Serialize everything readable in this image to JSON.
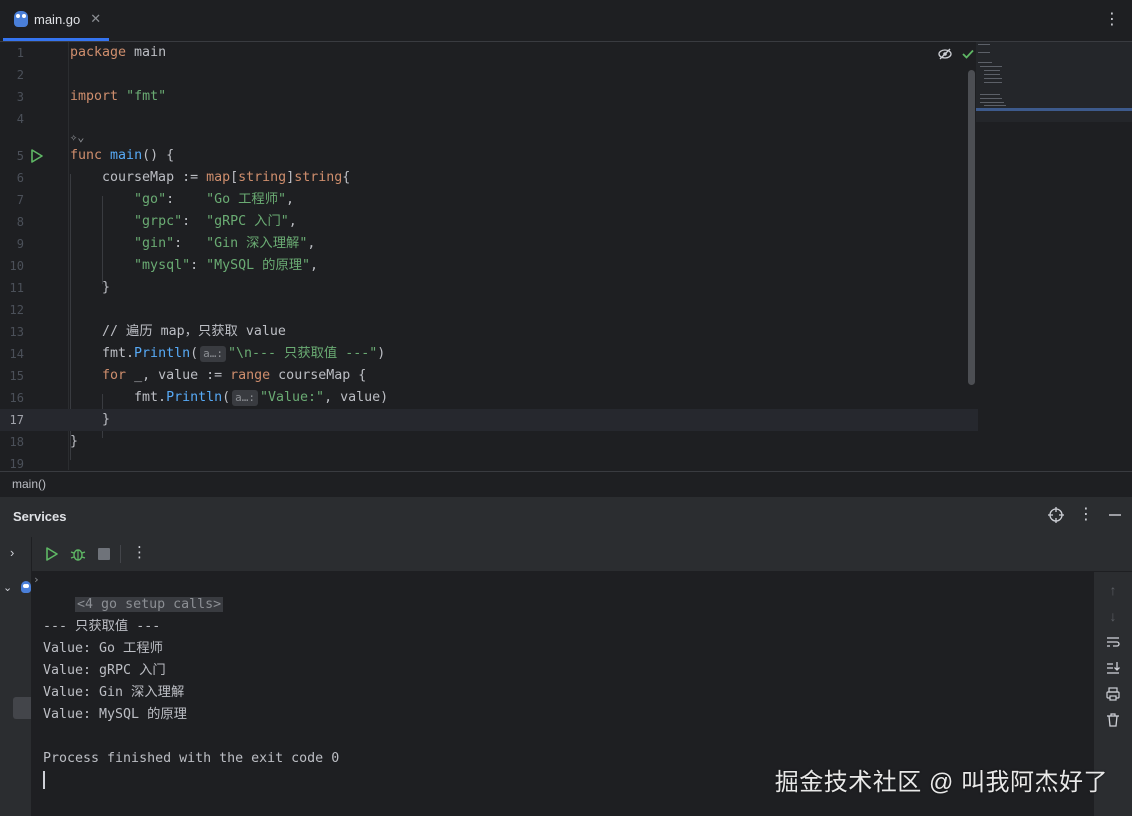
{
  "tab": {
    "filename": "main.go"
  },
  "editor": {
    "lines": [
      {
        "n": "1",
        "code": "package main"
      },
      {
        "n": "2",
        "code": ""
      },
      {
        "n": "3",
        "code": "import \"fmt\""
      },
      {
        "n": "4",
        "code": ""
      },
      {
        "n": "5",
        "code": "func main() {"
      },
      {
        "n": "6",
        "code": "    courseMap := map[string]string{"
      },
      {
        "n": "7",
        "code": "        \"go\":    \"Go 工程师\","
      },
      {
        "n": "8",
        "code": "        \"grpc\":  \"gRPC 入门\","
      },
      {
        "n": "9",
        "code": "        \"gin\":   \"Gin 深入理解\","
      },
      {
        "n": "10",
        "code": "        \"mysql\": \"MySQL 的原理\","
      },
      {
        "n": "11",
        "code": "    }"
      },
      {
        "n": "12",
        "code": ""
      },
      {
        "n": "13",
        "code": "    // 遍历 map，只获取 value"
      },
      {
        "n": "14",
        "code": "    fmt.Println(a…: \"\\n--- 只获取值 ---\")"
      },
      {
        "n": "15",
        "code": "    for _, value := range courseMap {"
      },
      {
        "n": "16",
        "code": "        fmt.Println(a…: \"Value:\", value)"
      },
      {
        "n": "17",
        "code": "    }"
      },
      {
        "n": "18",
        "code": "}"
      },
      {
        "n": "19",
        "code": ""
      }
    ],
    "param_hint": "a…:"
  },
  "breadcrumb": "main()",
  "services": {
    "title": "Services",
    "console": {
      "setup_calls": "<4 go setup calls>",
      "output": [
        "--- 只获取值 ---",
        "Value: Go 工程师",
        "Value: gRPC 入门",
        "Value: Gin 深入理解",
        "Value: MySQL 的原理"
      ],
      "finished": "Process finished with the exit code 0"
    }
  },
  "watermark": "掘金技术社区 @ 叫我阿杰好了",
  "colors": {
    "accent": "#3574f0",
    "run_green": "#5fb865",
    "keyword": "#cf8e6d",
    "function": "#57aaf7",
    "string": "#6aab73"
  }
}
